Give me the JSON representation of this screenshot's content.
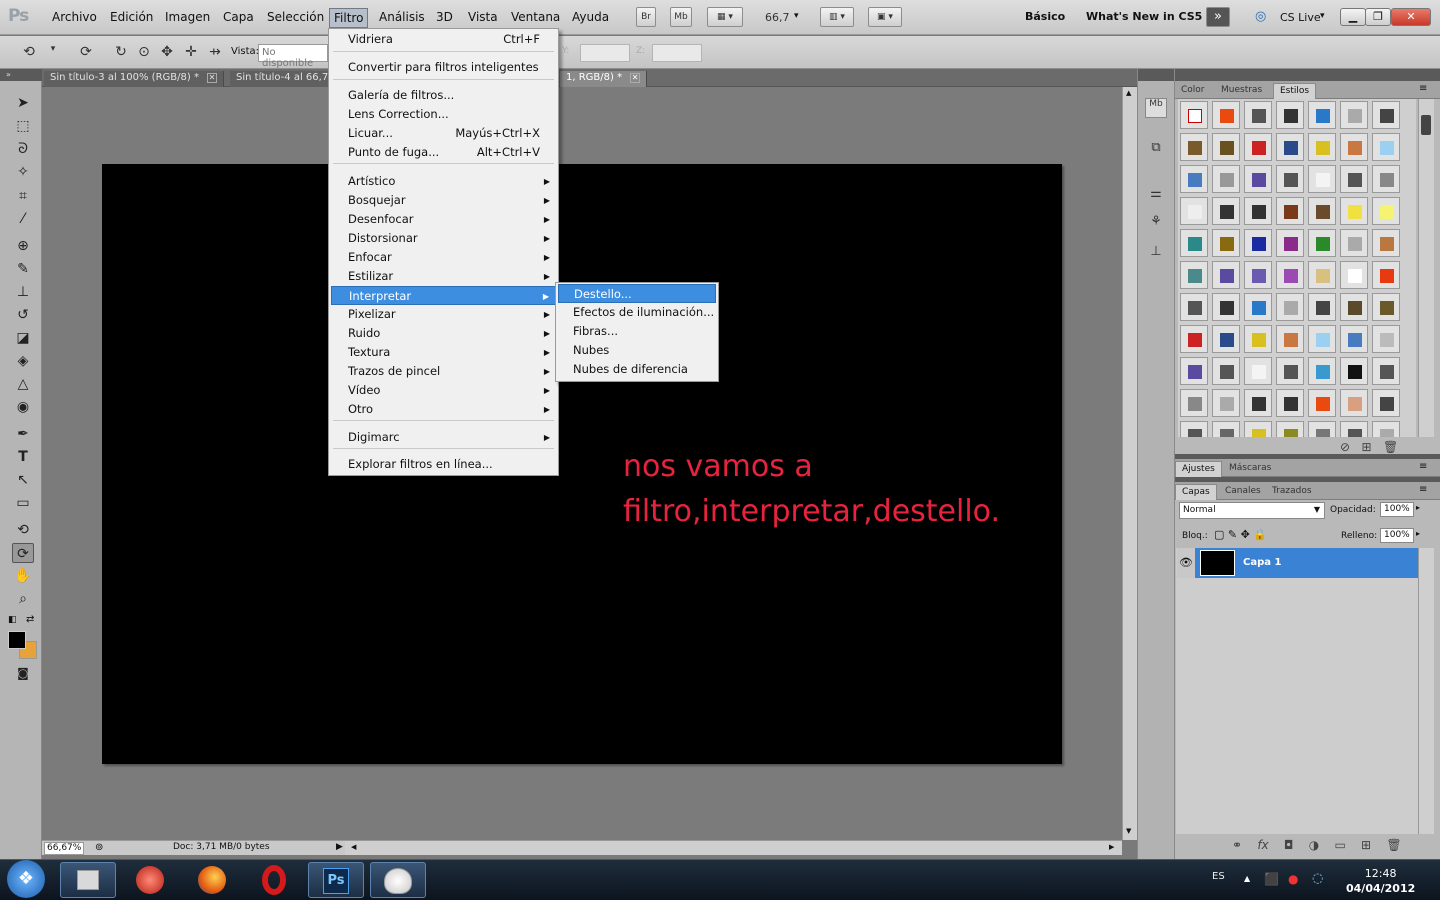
{
  "app": {
    "logo": "Ps"
  },
  "menubar": {
    "items": [
      "Archivo",
      "Edición",
      "Imagen",
      "Capa",
      "Selección",
      "Filtro",
      "Análisis",
      "3D",
      "Vista",
      "Ventana",
      "Ayuda"
    ],
    "zoom": "66,7",
    "workspace_basic": "Básico",
    "workspace_new": "What's New in CS5",
    "cs_live": "CS Live",
    "br_label": "Br",
    "mb_label": "Mb"
  },
  "options": {
    "vista_label": "Vista:",
    "vista_value": "No disponible",
    "y_label": "Y:",
    "z_label": "Z:"
  },
  "doc_tabs": [
    {
      "label": "Sin título-3 al 100% (RGB/8) *"
    },
    {
      "label": "Sin título-4 al 66,7"
    },
    {
      "label": "1, RGB/8) *"
    }
  ],
  "filter_menu": {
    "items": [
      {
        "label": "Vidriera",
        "shortcut": "Ctrl+F"
      },
      {
        "label": "Convertir para filtros inteligentes"
      },
      {
        "label": "Galería de filtros..."
      },
      {
        "label": "Lens Correction..."
      },
      {
        "label": "Licuar...",
        "shortcut": "Mayús+Ctrl+X"
      },
      {
        "label": "Punto de fuga...",
        "shortcut": "Alt+Ctrl+V"
      },
      {
        "label": "Artístico"
      },
      {
        "label": "Bosquejar"
      },
      {
        "label": "Desenfocar"
      },
      {
        "label": "Distorsionar"
      },
      {
        "label": "Enfocar"
      },
      {
        "label": "Estilizar"
      },
      {
        "label": "Interpretar"
      },
      {
        "label": "Pixelizar"
      },
      {
        "label": "Ruido"
      },
      {
        "label": "Textura"
      },
      {
        "label": "Trazos de pincel"
      },
      {
        "label": "Vídeo"
      },
      {
        "label": "Otro"
      },
      {
        "label": "Digimarc"
      },
      {
        "label": "Explorar filtros en línea..."
      }
    ]
  },
  "render_submenu": {
    "items": [
      "Destello...",
      "Efectos de iluminación...",
      "Fibras...",
      "Nubes",
      "Nubes de diferencia"
    ]
  },
  "annotation": {
    "line1": "nos vamos a",
    "line2": "filtro,interpretar,destello."
  },
  "status": {
    "zoom": "66,67%",
    "doc": "Doc: 3,71 MB/0 bytes"
  },
  "panels": {
    "top_tabs": [
      "Color",
      "Muestras",
      "Estilos"
    ],
    "mid_tabs": [
      "Ajustes",
      "Máscaras"
    ],
    "layer_tabs": [
      "Capas",
      "Canales",
      "Trazados"
    ],
    "blend_mode": "Normal",
    "opacity_label": "Opacidad:",
    "opacity_value": "100%",
    "lock_label": "Bloq.:",
    "fill_label": "Relleno:",
    "fill_value": "100%",
    "layer_name": "Capa 1"
  },
  "taskbar": {
    "lang": "ES",
    "time": "12:48",
    "date": "04/04/2012"
  },
  "colors": {
    "accent": "#3d8ee0",
    "annotation": "#e8233e",
    "foreground": "#000000",
    "background": "#e8a23a"
  }
}
